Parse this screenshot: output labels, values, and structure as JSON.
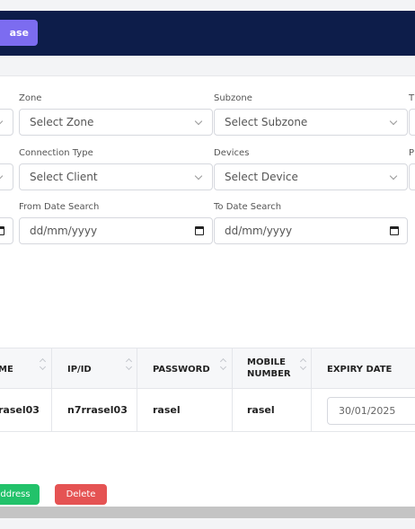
{
  "header": {
    "case_button_label": "ase"
  },
  "filters": {
    "zone": {
      "label": "Zone",
      "placeholder": "Select Zone"
    },
    "subzone": {
      "label": "Subzone",
      "placeholder": "Select Subzone"
    },
    "t_label_partial": "T",
    "connection_type": {
      "label": "Connection Type",
      "placeholder": "Select Client"
    },
    "devices": {
      "label": "Devices",
      "placeholder": "Select Device"
    },
    "p_label_partial": "P",
    "from_date": {
      "label": "From Date Search",
      "placeholder": "dd/mm/yyyy"
    },
    "to_date": {
      "label": "To Date Search",
      "placeholder": "dd/mm/yyyy"
    }
  },
  "table": {
    "columns": [
      "ME",
      "IP/ID",
      "PASSWORD",
      "MOBILE NUMBER",
      "EXPIRY DATE"
    ],
    "mobile_line1": "MOBILE",
    "mobile_line2": "NUMBER",
    "rows": [
      {
        "name": "rasel03",
        "ip_id": "n7rrasel03",
        "password": "rasel",
        "mobile": "rasel",
        "expiry": "30/01/2025"
      }
    ]
  },
  "actions": {
    "address_label": "ddress",
    "delete_label": "Delete"
  },
  "colors": {
    "header_bg": "#0d1d4a",
    "purple": "#7c6cf0",
    "green": "#22c26a",
    "red": "#e55353"
  }
}
